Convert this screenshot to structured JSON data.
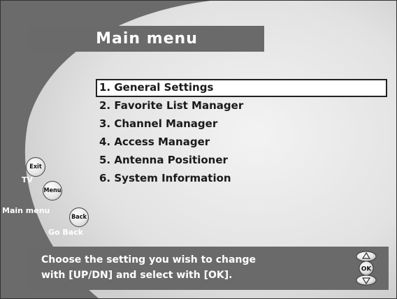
{
  "title": "Main menu",
  "menu": {
    "selected_index": 0,
    "items": [
      {
        "label": "1. General Settings"
      },
      {
        "label": "2. Favorite List Manager"
      },
      {
        "label": "3. Channel Manager"
      },
      {
        "label": "4. Access Manager"
      },
      {
        "label": "5. Antenna Positioner"
      },
      {
        "label": "6. System Information"
      }
    ]
  },
  "keys": {
    "exit": {
      "button": "Exit",
      "label": "TV"
    },
    "menu": {
      "button": "Menu",
      "label": "Main menu"
    },
    "back": {
      "button": "Back",
      "label": "Go Back"
    }
  },
  "help": {
    "line1": "Choose the setting you wish to change",
    "line2": "with [UP/DN] and select with [OK].",
    "ok_button": "OK",
    "icons": [
      "up-arrow-icon",
      "ok-icon",
      "down-arrow-icon"
    ]
  },
  "colors": {
    "background": "#6b6b6b",
    "panel": "#e2e2e2",
    "bar": "#6a6a6a",
    "text_light": "#ffffff",
    "text_dark": "#1a1a1a"
  }
}
